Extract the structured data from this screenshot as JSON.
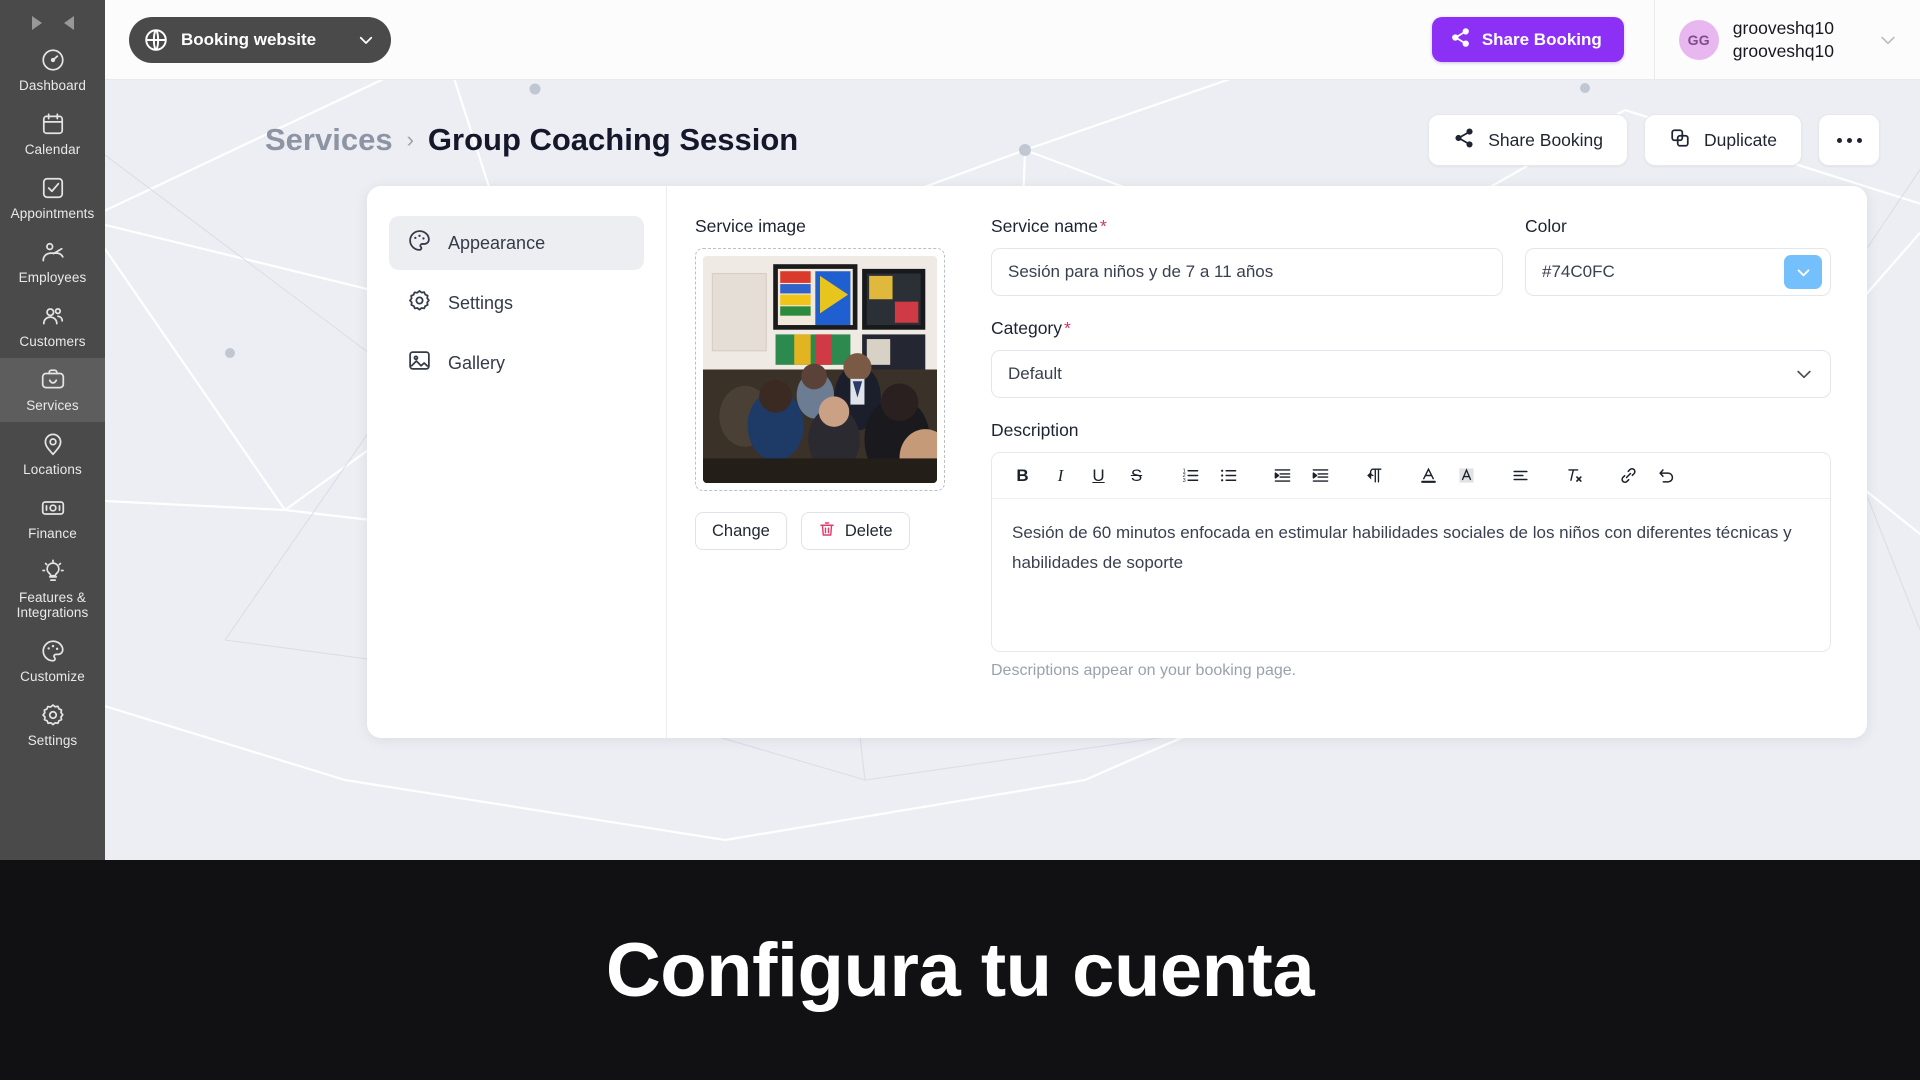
{
  "sidebar": {
    "collapse_controls": [
      "expand-arrow",
      "collapse-arrow"
    ],
    "items": [
      {
        "label": "Dashboard",
        "icon": "speedometer-icon",
        "active": false
      },
      {
        "label": "Calendar",
        "icon": "calendar-icon",
        "active": false
      },
      {
        "label": "Appointments",
        "icon": "checkbox-icon",
        "active": false
      },
      {
        "label": "Employees",
        "icon": "employees-icon",
        "active": false
      },
      {
        "label": "Customers",
        "icon": "customers-icon",
        "active": false
      },
      {
        "label": "Services",
        "icon": "briefcase-icon",
        "active": true
      },
      {
        "label": "Locations",
        "icon": "pin-icon",
        "active": false
      },
      {
        "label": "Finance",
        "icon": "banknote-icon",
        "active": false
      },
      {
        "label": "Features & Integrations",
        "icon": "bulb-icon",
        "active": false
      },
      {
        "label": "Customize",
        "icon": "palette-icon",
        "active": false
      },
      {
        "label": "Settings",
        "icon": "gear-icon",
        "active": false
      }
    ]
  },
  "topbar": {
    "site_selector": {
      "label": "Booking website",
      "icon": "globe-icon",
      "chevron": "chevron-down-icon"
    },
    "share_button": {
      "label": "Share Booking",
      "icon": "share-icon",
      "color": "#8C30F5"
    },
    "user": {
      "initials": "GG",
      "name_line1": "grooveshq10",
      "name_line2": "grooveshq10",
      "avatar_color": "#E9B7F0"
    }
  },
  "page": {
    "breadcrumb_parent": "Services",
    "breadcrumb_separator": "›",
    "breadcrumb_current": "Group Coaching Session",
    "actions": [
      {
        "label": "Share Booking",
        "icon": "share-icon"
      },
      {
        "label": "Duplicate",
        "icon": "duplicate-icon"
      }
    ],
    "more_button": "more-options-icon"
  },
  "tabs": [
    {
      "label": "Appearance",
      "icon": "palette-icon",
      "active": true
    },
    {
      "label": "Settings",
      "icon": "gear-icon",
      "active": false
    },
    {
      "label": "Gallery",
      "icon": "image-icon",
      "active": false
    }
  ],
  "form": {
    "image_label": "Service image",
    "change_button": "Change",
    "delete_button": "Delete",
    "delete_icon_color": "#E03A6D",
    "name_label": "Service name",
    "name_required": "*",
    "name_value": "Sesión para niños y de 7 a 11 años",
    "color_label": "Color",
    "color_value": "#74C0FC",
    "category_label": "Category",
    "category_required": "*",
    "category_value": "Default",
    "description_label": "Description",
    "description_text": "Sesión de 60 minutos enfocada en estimular habilidades sociales de los niños con diferentes técnicas y habilidades de soporte",
    "description_hint": "Descriptions appear on your booking page.",
    "toolbar": [
      {
        "name": "bold-icon",
        "glyph": "B"
      },
      {
        "name": "italic-icon",
        "glyph": "I"
      },
      {
        "name": "underline-icon",
        "glyph": "U"
      },
      {
        "name": "strikethrough-icon",
        "glyph": "S"
      },
      {
        "name": "ordered-list-icon",
        "glyph": ""
      },
      {
        "name": "bullet-list-icon",
        "glyph": ""
      },
      {
        "name": "outdent-icon",
        "glyph": ""
      },
      {
        "name": "indent-icon",
        "glyph": ""
      },
      {
        "name": "text-direction-icon",
        "glyph": ""
      },
      {
        "name": "font-color-icon",
        "glyph": "A"
      },
      {
        "name": "highlight-color-icon",
        "glyph": "A"
      },
      {
        "name": "align-icon",
        "glyph": ""
      },
      {
        "name": "clear-format-icon",
        "glyph": ""
      },
      {
        "name": "link-icon",
        "glyph": ""
      },
      {
        "name": "undo-icon",
        "glyph": ""
      }
    ]
  },
  "banner": {
    "heading": "Configura tu cuenta",
    "background": "#111113"
  }
}
